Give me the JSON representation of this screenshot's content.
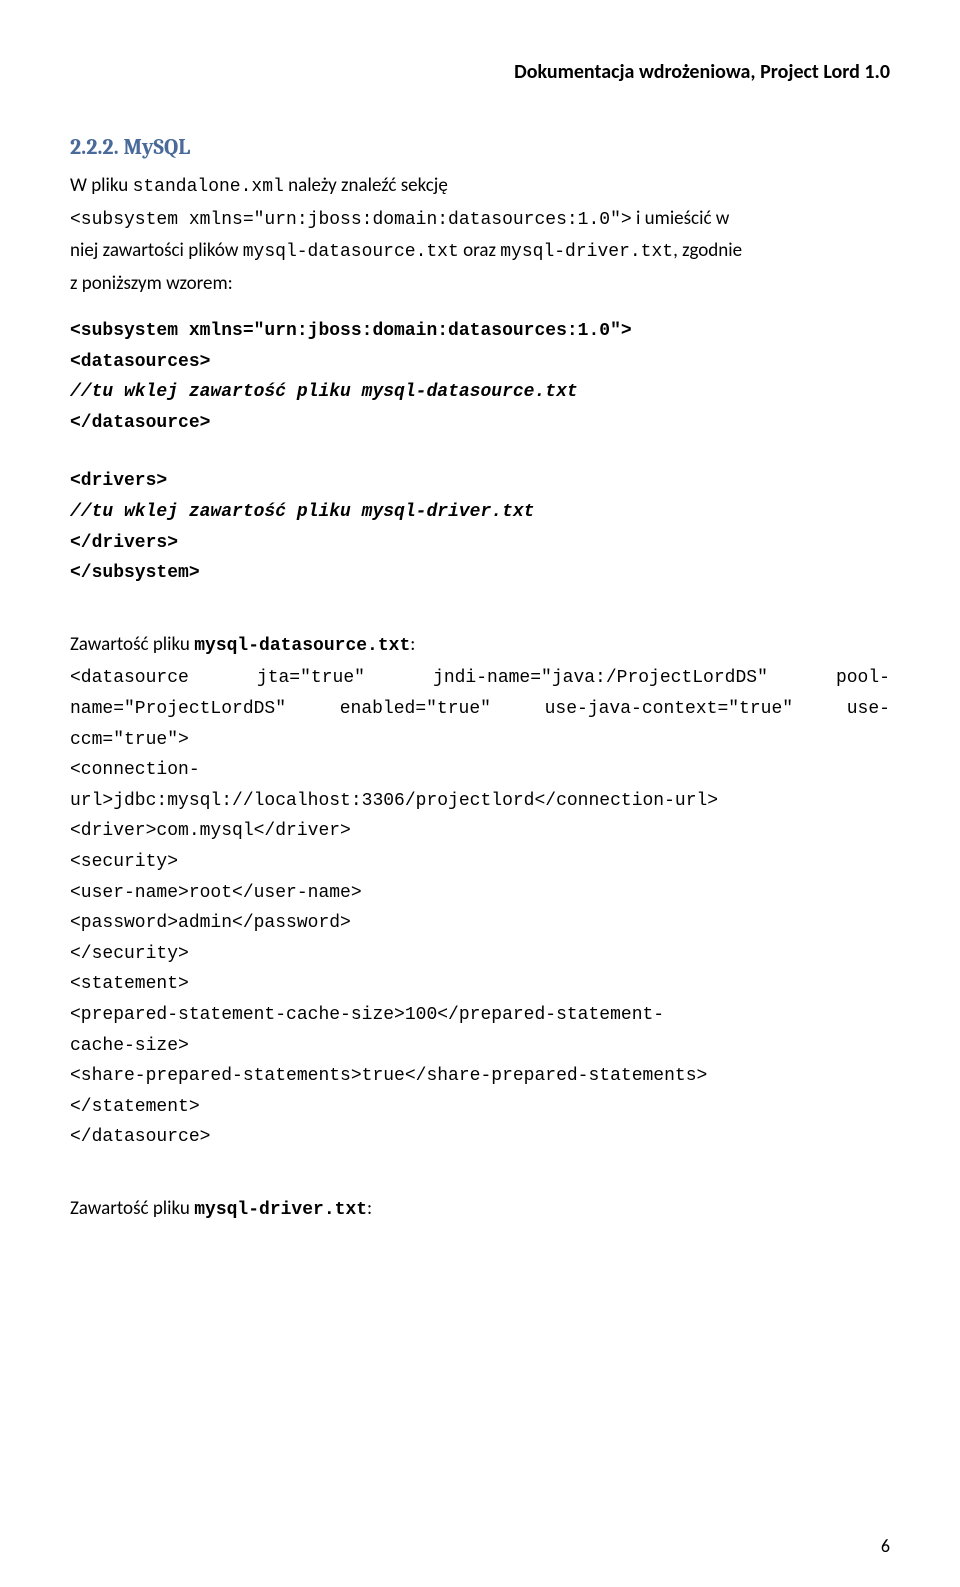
{
  "header": "Dokumentacja wdrożeniowa, Project Lord 1.0",
  "section": {
    "number": "2.2.2.",
    "title": "MySQL"
  },
  "intro": {
    "l1a": "W pliku ",
    "l1b": "standalone.xml",
    "l1c": "  należy znaleźć sekcję",
    "l2": "<subsystem xmlns=\"urn:jboss:domain:datasources:1.0\">",
    "l2b": " i umieścić w",
    "l3a": "niej zawartości plików ",
    "l3b": "mysql-datasource.txt",
    "l3c": " oraz ",
    "l3d": "mysql-driver.txt",
    "l3e": ", zgodnie",
    "l4": "z poniższym wzorem:"
  },
  "template": {
    "t1": "<subsystem xmlns=\"urn:jboss:domain:datasources:1.0\">",
    "t2": "<datasources>",
    "t3a": "//tu wklej zawartość pliku ",
    "t3b": "mysql-datasource.txt",
    "t4": "</datasource>",
    "t5": "<drivers>",
    "t6a": "//tu wklej zawartość pliku ",
    "t6b": "mysql-driver.txt",
    "t7": "</drivers>",
    "t8": "</subsystem>"
  },
  "ds_label_a": "Zawartość pliku ",
  "ds_label_b": "mysql-datasource.txt",
  "ds_label_c": ":",
  "ds": {
    "l1a": "<datasource",
    "l1b": "jta=\"true\"",
    "l1c": "jndi-name=\"java:/ProjectLordDS\"",
    "l1d": "pool-",
    "l2a": "name=\"ProjectLordDS\"",
    "l2b": "enabled=\"true\"",
    "l2c": "use-java-context=\"true\"",
    "l2d": "use-",
    "l3": "ccm=\"true\">",
    "l4": "<connection-",
    "l5": "url>jdbc:mysql://localhost:3306/projectlord</connection-url>",
    "l6": "<driver>com.mysql</driver>",
    "l7": "<security>",
    "l8": "<user-name>root</user-name>",
    "l9": "<password>admin</password>",
    "l10": "</security>",
    "l11": "<statement>",
    "l12": "<prepared-statement-cache-size>100</prepared-statement-",
    "l13": "cache-size>",
    "l14": "<share-prepared-statements>true</share-prepared-statements>",
    "l15": "</statement>",
    "l16": "</datasource>"
  },
  "drv_label_a": "Zawartość pliku ",
  "drv_label_b": "mysql-driver.txt",
  "drv_label_c": ":",
  "page_number": "6"
}
